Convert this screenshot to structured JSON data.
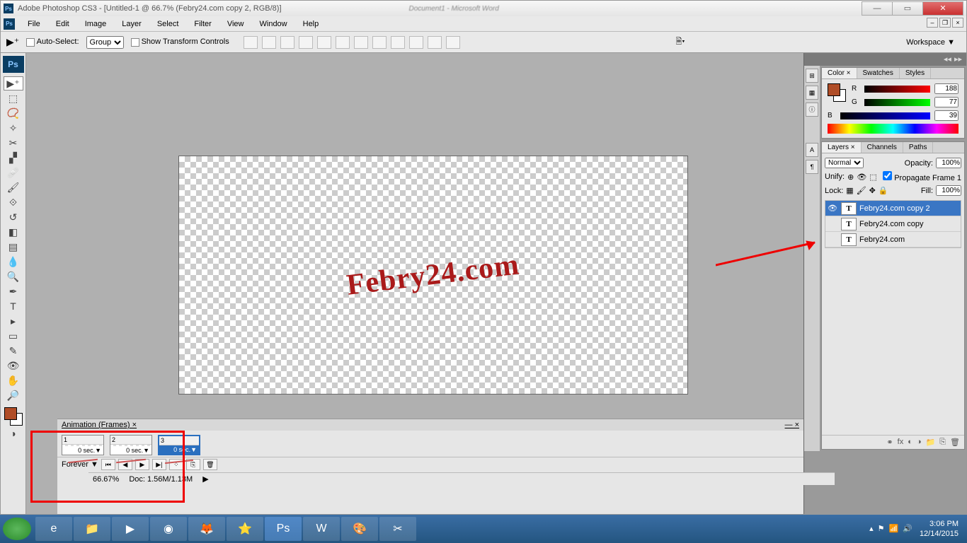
{
  "titlebar": {
    "app_title": "Adobe Photoshop CS3 - [Untitled-1 @ 66.7% (Febry24.com copy 2, RGB/8)]",
    "bg_app": "Document1 - Microsoft Word"
  },
  "menu": {
    "items": [
      "File",
      "Edit",
      "Image",
      "Layer",
      "Select",
      "Filter",
      "View",
      "Window",
      "Help"
    ]
  },
  "options": {
    "auto_select_label": "Auto-Select:",
    "auto_select_value": "Group",
    "show_transform": "Show Transform Controls",
    "workspace_label": "Workspace ▼"
  },
  "canvas": {
    "text": "Febry24.com"
  },
  "animation": {
    "title": "Animation (Frames) ×",
    "frames": [
      {
        "num": "1",
        "delay": "0 sec.▼"
      },
      {
        "num": "2",
        "delay": "0 sec.▼"
      },
      {
        "num": "3",
        "delay": "0 sec.▼"
      }
    ],
    "loop": "Forever ▼"
  },
  "status": {
    "zoom": "66.67%",
    "doc": "Doc: 1.56M/1.13M"
  },
  "color_panel": {
    "tabs": [
      "Color ×",
      "Swatches",
      "Styles"
    ],
    "r_label": "R",
    "r_val": "188",
    "g_label": "G",
    "g_val": "77",
    "b_label": "B",
    "b_val": "39"
  },
  "layers_panel": {
    "tabs": [
      "Layers ×",
      "Channels",
      "Paths"
    ],
    "blend": "Normal",
    "opacity_label": "Opacity:",
    "opacity_val": "100%",
    "unify_label": "Unify:",
    "propagate_label": "Propagate Frame 1",
    "lock_label": "Lock:",
    "fill_label": "Fill:",
    "fill_val": "100%",
    "layers": [
      {
        "name": "Febry24.com copy 2",
        "selected": true
      },
      {
        "name": "Febry24.com copy",
        "selected": false
      },
      {
        "name": "Febry24.com",
        "selected": false
      }
    ]
  },
  "taskbar": {
    "time": "3:06 PM",
    "date": "12/14/2015"
  }
}
